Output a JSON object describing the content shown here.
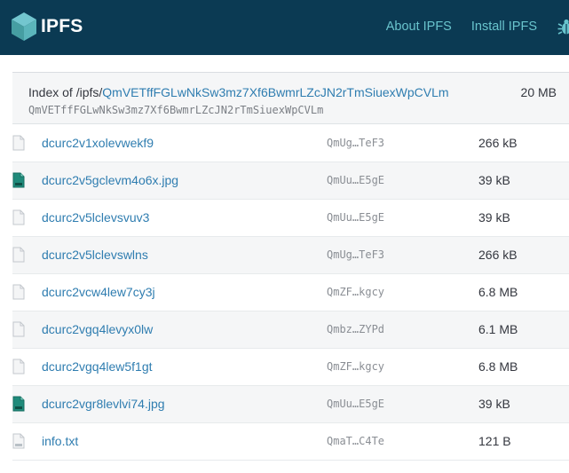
{
  "header": {
    "brand": "IPFS",
    "nav": [
      {
        "label": "About IPFS"
      },
      {
        "label": "Install IPFS"
      }
    ],
    "bug_icon": "bug-icon",
    "background": "#0b3a53",
    "link_color": "#69c4cd"
  },
  "listing": {
    "index_prefix": "Index of /ipfs/",
    "cid": "QmVETffFGLwNkSw3mz7Xf6BwmrLZcJN2rTmSiuexWpCVLm",
    "cid_mono": "QmVETffFGLwNkSw3mz7Xf6BwmrLZcJN2rTmSiuexWpCVLm",
    "total_size": "20 MB",
    "link_color": "#2f7db0",
    "files": [
      {
        "icon": "generic-file-icon",
        "name": "dcurc2v1xolevwekf9",
        "hash": "QmUg…TeF3",
        "size": "266 kB"
      },
      {
        "icon": "jpg-file-icon",
        "name": "dcurc2v5gclevm4o6x.jpg",
        "hash": "QmUu…E5gE",
        "size": "39 kB"
      },
      {
        "icon": "generic-file-icon",
        "name": "dcurc2v5lclevsvuv3",
        "hash": "QmUu…E5gE",
        "size": "39 kB"
      },
      {
        "icon": "generic-file-icon",
        "name": "dcurc2v5lclevswlns",
        "hash": "QmUg…TeF3",
        "size": "266 kB"
      },
      {
        "icon": "generic-file-icon",
        "name": "dcurc2vcw4lew7cy3j",
        "hash": "QmZF…kgcy",
        "size": "6.8 MB"
      },
      {
        "icon": "generic-file-icon",
        "name": "dcurc2vgq4levyx0lw",
        "hash": "Qmbz…ZYPd",
        "size": "6.1 MB"
      },
      {
        "icon": "generic-file-icon",
        "name": "dcurc2vgq4lew5f1gt",
        "hash": "QmZF…kgcy",
        "size": "6.8 MB"
      },
      {
        "icon": "jpg-file-icon",
        "name": "dcurc2vgr8levlvi74.jpg",
        "hash": "QmUu…E5gE",
        "size": "39 kB"
      },
      {
        "icon": "txt-file-icon",
        "name": "info.txt",
        "hash": "QmaT…C4Te",
        "size": "121 B"
      }
    ]
  }
}
